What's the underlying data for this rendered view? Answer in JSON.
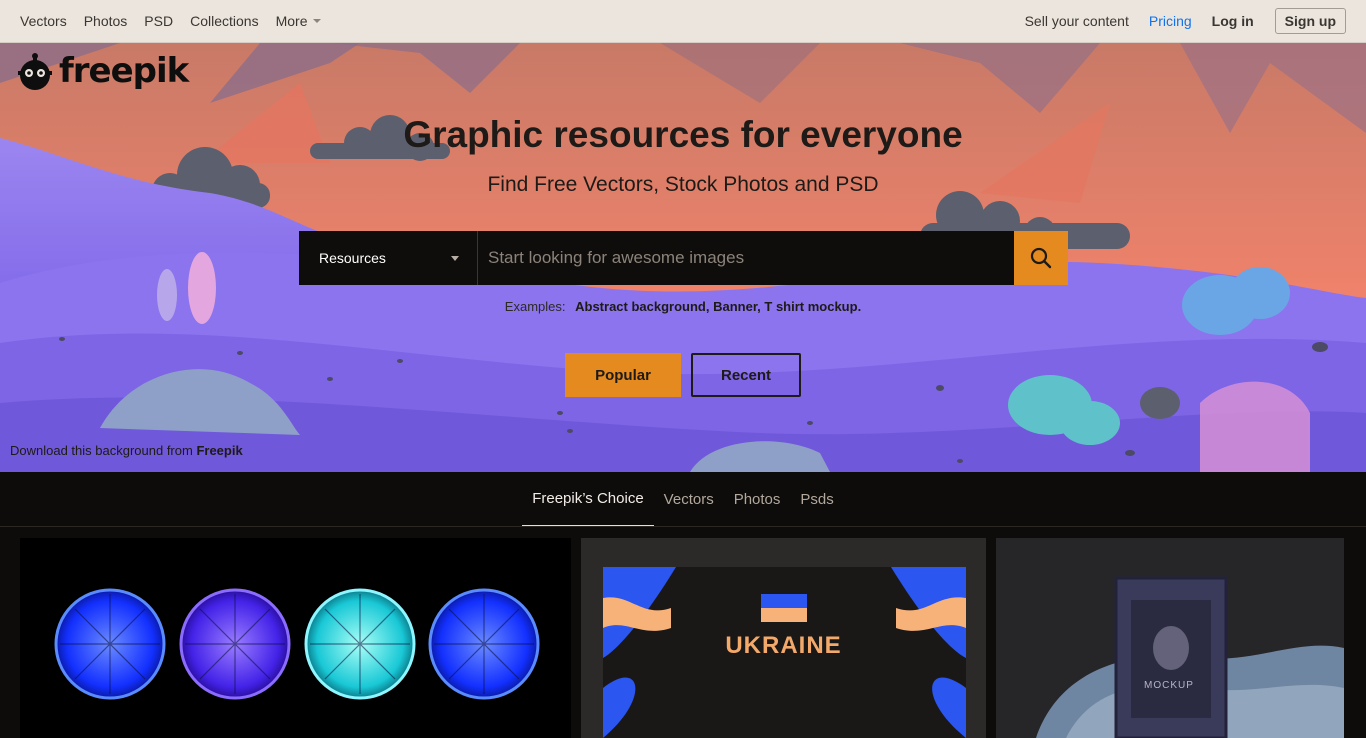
{
  "nav": {
    "left": [
      "Vectors",
      "Photos",
      "PSD",
      "Collections"
    ],
    "more": "More",
    "sell": "Sell your content",
    "pricing": "Pricing",
    "login": "Log in",
    "signup": "Sign up"
  },
  "hero": {
    "logo": "freepik",
    "title": "Graphic resources for everyone",
    "subtitle": "Find Free Vectors, Stock Photos and PSD",
    "search": {
      "type_label": "Resources",
      "placeholder": "Start looking for awesome images"
    },
    "examples_label": "Examples:",
    "examples": "Abstract background, Banner, T shirt mockup.",
    "popular": "Popular",
    "recent": "Recent",
    "credit_prefix": "Download this background from ",
    "credit_brand": "Freepik"
  },
  "tabs": [
    "Freepik’s Choice",
    "Vectors",
    "Photos",
    "Psds"
  ],
  "active_tab": "Freepik’s Choice",
  "cards": {
    "ukraine_title": "UKRAINE",
    "mockup_label": "MOCKUP"
  },
  "colors": {
    "accent": "#e58a1f",
    "link": "#1273eb",
    "nav_bg": "#ebe5de",
    "dark_bg": "#0d0c0a"
  },
  "icons": [
    "search-icon",
    "freepik-logo-icon",
    "caret-down-icon"
  ]
}
